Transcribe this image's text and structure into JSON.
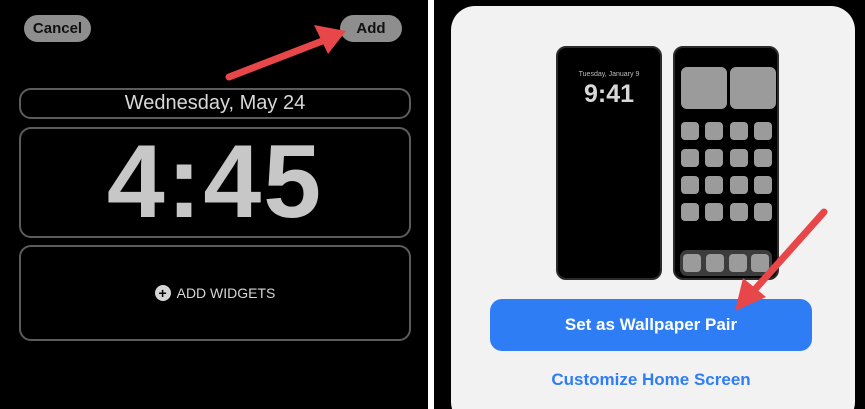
{
  "left_panel": {
    "cancel_label": "Cancel",
    "add_label": "Add",
    "date_text": "Wednesday, May 24",
    "time_text": "4:45",
    "add_widgets_label": "ADD WIDGETS"
  },
  "right_panel": {
    "lock_preview_date": "Tuesday, January 9",
    "lock_preview_time": "9:41",
    "primary_button_label": "Set as Wallpaper Pair",
    "secondary_link_label": "Customize Home Screen"
  },
  "colors": {
    "accent_blue": "#2f7df5",
    "annotation_arrow": "#e8474a"
  },
  "icons": [
    "plus-circle-icon",
    "annotation-arrow-icon"
  ]
}
